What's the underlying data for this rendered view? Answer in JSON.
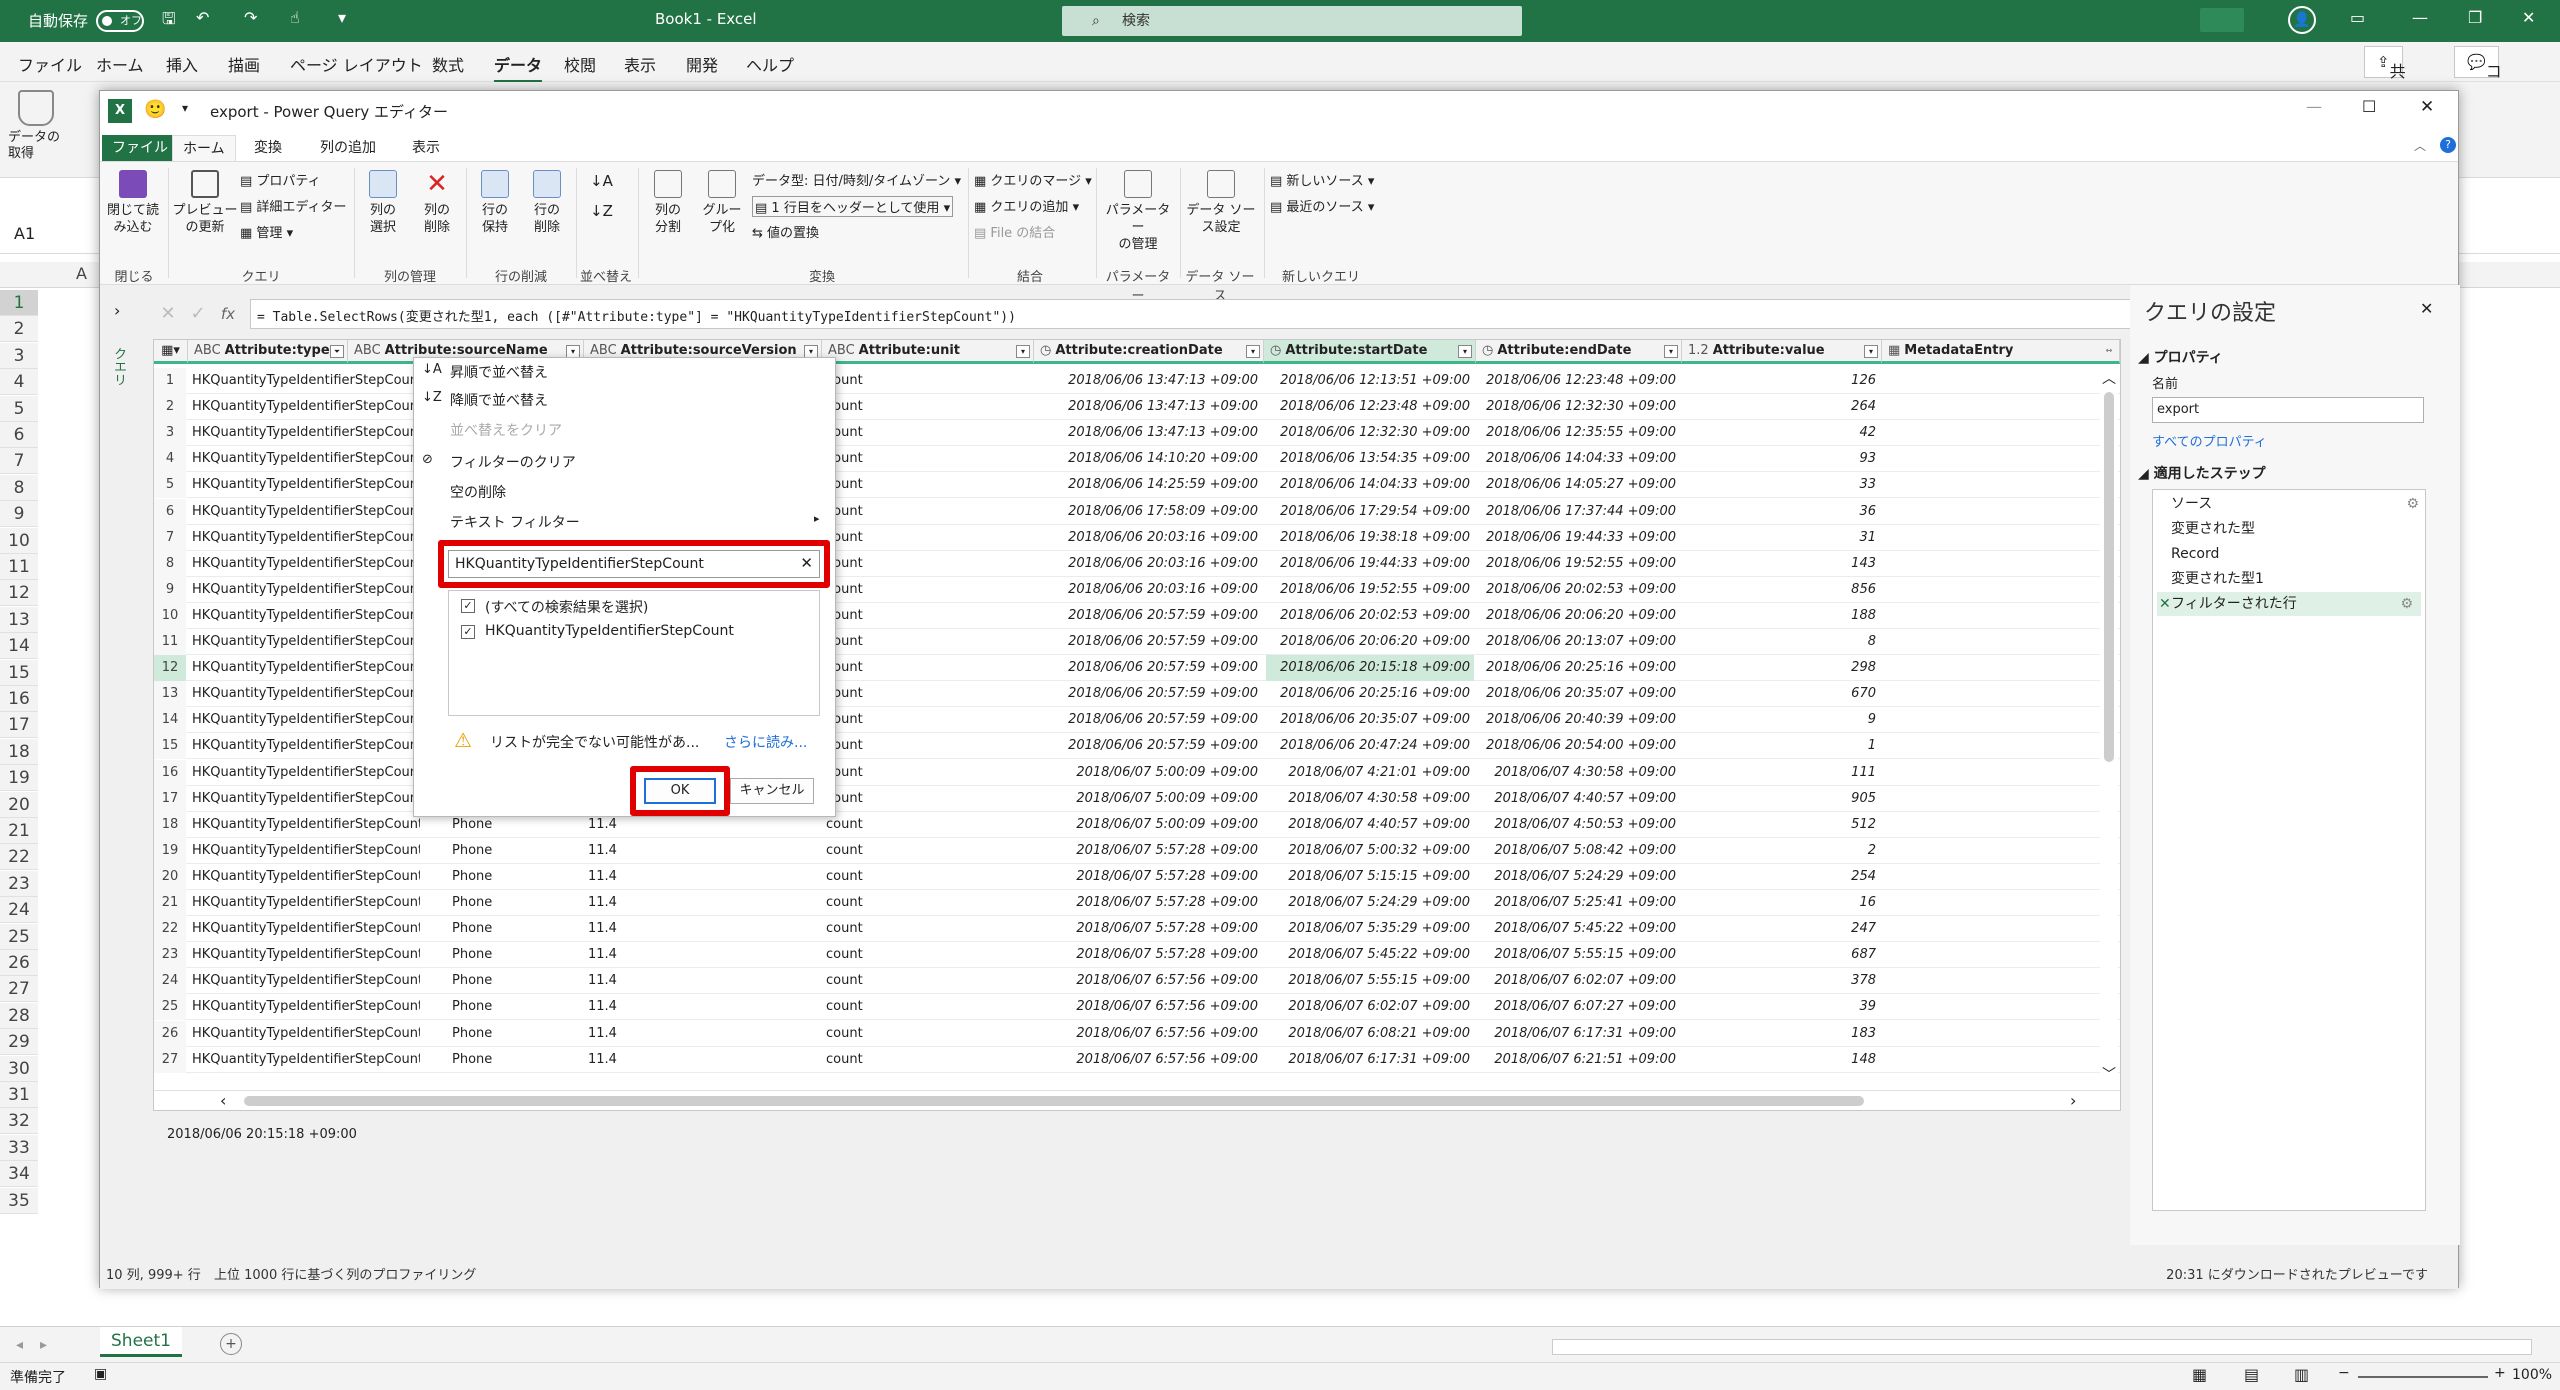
{
  "excel": {
    "autosave_label": "自動保存",
    "autosave_state": "オフ",
    "doc_title": "Book1  -  Excel",
    "search_placeholder": "検索",
    "menu": [
      "ファイル",
      "ホーム",
      "挿入",
      "描画",
      "ページ レイアウト",
      "数式",
      "データ",
      "校閲",
      "表示",
      "開発",
      "ヘルプ"
    ],
    "active_menu": "データ",
    "share_label": "共有",
    "comment_label": "コメント",
    "get_data_label": "データの\n取得",
    "name_box": "A1",
    "col_a": "A",
    "rows": [
      "1",
      "2",
      "3",
      "4",
      "5",
      "6",
      "7",
      "8",
      "9",
      "10",
      "11",
      "12",
      "13",
      "14",
      "15",
      "16",
      "17",
      "18",
      "19",
      "20",
      "21",
      "22",
      "23",
      "24",
      "25",
      "26",
      "27",
      "28",
      "29",
      "30",
      "31",
      "32",
      "33",
      "34",
      "35"
    ],
    "sheet_tab": "Sheet1",
    "status_ready": "準備完了",
    "zoom": "100%"
  },
  "pq": {
    "window_title": "export - Power Query エディター",
    "tabs": [
      "ファイル",
      "ホーム",
      "変換",
      "列の追加",
      "表示"
    ],
    "ribbon": {
      "close_load": "閉じて読\nみ込む",
      "preview_refresh": "プレビュー\nの更新",
      "properties": "プロパティ",
      "advanced_editor": "詳細エディター",
      "manage": "管理",
      "choose_columns": "列の\n選択",
      "remove_columns": "列の\n削除",
      "keep_rows": "行の\n保持",
      "remove_rows": "行の\n削除",
      "split_column": "列の\n分割",
      "group_by": "グルー\nプ化",
      "data_type": "データ型: 日付/時刻/タイムゾーン",
      "first_row_header": "1 行目をヘッダーとして使用",
      "replace_values": "値の置換",
      "merge_queries": "クエリのマージ",
      "append_queries": "クエリの追加",
      "combine_files": "File の結合",
      "manage_params": "パラメーター\nの管理",
      "data_source_settings": "データ ソー\nス設定",
      "new_source": "新しいソース",
      "recent_sources": "最近のソース",
      "groups": {
        "close": "閉じる",
        "query": "クエリ",
        "manage_cols": "列の管理",
        "reduce_rows": "行の削減",
        "sort": "並べ替え",
        "transform": "変換",
        "combine": "結合",
        "parameters": "パラメーター",
        "data_sources": "データ ソース",
        "new_query": "新しいクエリ"
      }
    },
    "queries_label": "クエリ",
    "formula": "= Table.SelectRows(変更された型1, each ([#\"Attribute:type\"] = \"HKQuantityTypeIdentifierStepCount\"))",
    "columns": [
      {
        "type": "ABC",
        "name": "Attribute:type"
      },
      {
        "type": "ABC",
        "name": "Attribute:sourceName"
      },
      {
        "type": "ABC",
        "name": "Attribute:sourceVersion"
      },
      {
        "type": "ABC",
        "name": "Attribute:unit"
      },
      {
        "type": "◷",
        "name": "Attribute:creationDate"
      },
      {
        "type": "◷",
        "name": "Attribute:startDate"
      },
      {
        "type": "◷",
        "name": "Attribute:endDate"
      },
      {
        "type": "1.2",
        "name": "Attribute:value"
      },
      {
        "type": "▦",
        "name": "MetadataEntry"
      }
    ],
    "rows": [
      {
        "n": "1",
        "type": "HKQuantityTypeIdentifierStepCount",
        "src": "",
        "ver": "",
        "unit": "count",
        "cd": "2018/06/06 13:47:13 +09:00",
        "sd": "2018/06/06 12:13:51 +09:00",
        "ed": "2018/06/06 12:23:48 +09:00",
        "v": "126"
      },
      {
        "n": "2",
        "type": "HKQuantityTypeIdentifierStepCount",
        "src": "",
        "ver": "",
        "unit": "count",
        "cd": "2018/06/06 13:47:13 +09:00",
        "sd": "2018/06/06 12:23:48 +09:00",
        "ed": "2018/06/06 12:32:30 +09:00",
        "v": "264"
      },
      {
        "n": "3",
        "type": "HKQuantityTypeIdentifierStepCount",
        "src": "",
        "ver": "",
        "unit": "count",
        "cd": "2018/06/06 13:47:13 +09:00",
        "sd": "2018/06/06 12:32:30 +09:00",
        "ed": "2018/06/06 12:35:55 +09:00",
        "v": "42"
      },
      {
        "n": "4",
        "type": "HKQuantityTypeIdentifierStepCount",
        "src": "",
        "ver": "",
        "unit": "count",
        "cd": "2018/06/06 14:10:20 +09:00",
        "sd": "2018/06/06 13:54:35 +09:00",
        "ed": "2018/06/06 14:04:33 +09:00",
        "v": "93"
      },
      {
        "n": "5",
        "type": "HKQuantityTypeIdentifierStepCount",
        "src": "",
        "ver": "",
        "unit": "count",
        "cd": "2018/06/06 14:25:59 +09:00",
        "sd": "2018/06/06 14:04:33 +09:00",
        "ed": "2018/06/06 14:05:27 +09:00",
        "v": "33"
      },
      {
        "n": "6",
        "type": "HKQuantityTypeIdentifierStepCount",
        "src": "",
        "ver": "",
        "unit": "count",
        "cd": "2018/06/06 17:58:09 +09:00",
        "sd": "2018/06/06 17:29:54 +09:00",
        "ed": "2018/06/06 17:37:44 +09:00",
        "v": "36"
      },
      {
        "n": "7",
        "type": "HKQuantityTypeIdentifierStepCount",
        "src": "",
        "ver": "",
        "unit": "count",
        "cd": "2018/06/06 20:03:16 +09:00",
        "sd": "2018/06/06 19:38:18 +09:00",
        "ed": "2018/06/06 19:44:33 +09:00",
        "v": "31"
      },
      {
        "n": "8",
        "type": "HKQuantityTypeIdentifierStepCount",
        "src": "",
        "ver": "",
        "unit": "count",
        "cd": "2018/06/06 20:03:16 +09:00",
        "sd": "2018/06/06 19:44:33 +09:00",
        "ed": "2018/06/06 19:52:55 +09:00",
        "v": "143"
      },
      {
        "n": "9",
        "type": "HKQuantityTypeIdentifierStepCount",
        "src": "",
        "ver": "",
        "unit": "count",
        "cd": "2018/06/06 20:03:16 +09:00",
        "sd": "2018/06/06 19:52:55 +09:00",
        "ed": "2018/06/06 20:02:53 +09:00",
        "v": "856"
      },
      {
        "n": "10",
        "type": "HKQuantityTypeIdentifierStepCount",
        "src": "",
        "ver": "",
        "unit": "count",
        "cd": "2018/06/06 20:57:59 +09:00",
        "sd": "2018/06/06 20:02:53 +09:00",
        "ed": "2018/06/06 20:06:20 +09:00",
        "v": "188"
      },
      {
        "n": "11",
        "type": "HKQuantityTypeIdentifierStepCount",
        "src": "",
        "ver": "",
        "unit": "count",
        "cd": "2018/06/06 20:57:59 +09:00",
        "sd": "2018/06/06 20:06:20 +09:00",
        "ed": "2018/06/06 20:13:07 +09:00",
        "v": "8"
      },
      {
        "n": "12",
        "type": "HKQuantityTypeIdentifierStepCount",
        "src": "",
        "ver": "",
        "unit": "count",
        "cd": "2018/06/06 20:57:59 +09:00",
        "sd": "2018/06/06 20:15:18 +09:00",
        "ed": "2018/06/06 20:25:16 +09:00",
        "v": "298"
      },
      {
        "n": "13",
        "type": "HKQuantityTypeIdentifierStepCount",
        "src": "",
        "ver": "",
        "unit": "count",
        "cd": "2018/06/06 20:57:59 +09:00",
        "sd": "2018/06/06 20:25:16 +09:00",
        "ed": "2018/06/06 20:35:07 +09:00",
        "v": "670"
      },
      {
        "n": "14",
        "type": "HKQuantityTypeIdentifierStepCount",
        "src": "",
        "ver": "",
        "unit": "count",
        "cd": "2018/06/06 20:57:59 +09:00",
        "sd": "2018/06/06 20:35:07 +09:00",
        "ed": "2018/06/06 20:40:39 +09:00",
        "v": "9"
      },
      {
        "n": "15",
        "type": "HKQuantityTypeIdentifierStepCount",
        "src": "",
        "ver": "",
        "unit": "count",
        "cd": "2018/06/06 20:57:59 +09:00",
        "sd": "2018/06/06 20:47:24 +09:00",
        "ed": "2018/06/06 20:54:00 +09:00",
        "v": "1"
      },
      {
        "n": "16",
        "type": "HKQuantityTypeIdentifierStepCount",
        "src": "",
        "ver": "",
        "unit": "count",
        "cd": "2018/06/07 5:00:09 +09:00",
        "sd": "2018/06/07 4:21:01 +09:00",
        "ed": "2018/06/07 4:30:58 +09:00",
        "v": "111"
      },
      {
        "n": "17",
        "type": "HKQuantityTypeIdentifierStepCount",
        "src": "",
        "ver": "",
        "unit": "count",
        "cd": "2018/06/07 5:00:09 +09:00",
        "sd": "2018/06/07 4:30:58 +09:00",
        "ed": "2018/06/07 4:40:57 +09:00",
        "v": "905"
      },
      {
        "n": "18",
        "type": "HKQuantityTypeIdentifierStepCount",
        "src": "Phone",
        "ver": "11.4",
        "unit": "count",
        "cd": "2018/06/07 5:00:09 +09:00",
        "sd": "2018/06/07 4:40:57 +09:00",
        "ed": "2018/06/07 4:50:53 +09:00",
        "v": "512"
      },
      {
        "n": "19",
        "type": "HKQuantityTypeIdentifierStepCount",
        "src": "Phone",
        "ver": "11.4",
        "unit": "count",
        "cd": "2018/06/07 5:57:28 +09:00",
        "sd": "2018/06/07 5:00:32 +09:00",
        "ed": "2018/06/07 5:08:42 +09:00",
        "v": "2"
      },
      {
        "n": "20",
        "type": "HKQuantityTypeIdentifierStepCount",
        "src": "Phone",
        "ver": "11.4",
        "unit": "count",
        "cd": "2018/06/07 5:57:28 +09:00",
        "sd": "2018/06/07 5:15:15 +09:00",
        "ed": "2018/06/07 5:24:29 +09:00",
        "v": "254"
      },
      {
        "n": "21",
        "type": "HKQuantityTypeIdentifierStepCount",
        "src": "Phone",
        "ver": "11.4",
        "unit": "count",
        "cd": "2018/06/07 5:57:28 +09:00",
        "sd": "2018/06/07 5:24:29 +09:00",
        "ed": "2018/06/07 5:25:41 +09:00",
        "v": "16"
      },
      {
        "n": "22",
        "type": "HKQuantityTypeIdentifierStepCount",
        "src": "Phone",
        "ver": "11.4",
        "unit": "count",
        "cd": "2018/06/07 5:57:28 +09:00",
        "sd": "2018/06/07 5:35:29 +09:00",
        "ed": "2018/06/07 5:45:22 +09:00",
        "v": "247"
      },
      {
        "n": "23",
        "type": "HKQuantityTypeIdentifierStepCount",
        "src": "Phone",
        "ver": "11.4",
        "unit": "count",
        "cd": "2018/06/07 5:57:28 +09:00",
        "sd": "2018/06/07 5:45:22 +09:00",
        "ed": "2018/06/07 5:55:15 +09:00",
        "v": "687"
      },
      {
        "n": "24",
        "type": "HKQuantityTypeIdentifierStepCount",
        "src": "Phone",
        "ver": "11.4",
        "unit": "count",
        "cd": "2018/06/07 6:57:56 +09:00",
        "sd": "2018/06/07 5:55:15 +09:00",
        "ed": "2018/06/07 6:02:07 +09:00",
        "v": "378"
      },
      {
        "n": "25",
        "type": "HKQuantityTypeIdentifierStepCount",
        "src": "Phone",
        "ver": "11.4",
        "unit": "count",
        "cd": "2018/06/07 6:57:56 +09:00",
        "sd": "2018/06/07 6:02:07 +09:00",
        "ed": "2018/06/07 6:07:27 +09:00",
        "v": "39"
      },
      {
        "n": "26",
        "type": "HKQuantityTypeIdentifierStepCount",
        "src": "Phone",
        "ver": "11.4",
        "unit": "count",
        "cd": "2018/06/07 6:57:56 +09:00",
        "sd": "2018/06/07 6:08:21 +09:00",
        "ed": "2018/06/07 6:17:31 +09:00",
        "v": "183"
      },
      {
        "n": "27",
        "type": "HKQuantityTypeIdentifierStepCount",
        "src": "Phone",
        "ver": "11.4",
        "unit": "count",
        "cd": "2018/06/07 6:57:56 +09:00",
        "sd": "2018/06/07 6:17:31 +09:00",
        "ed": "2018/06/07 6:21:51 +09:00",
        "v": "148"
      }
    ],
    "cell_preview": "2018/06/06 20:15:18 +09:00",
    "status_left": "10 列, 999+ 行",
    "status_mid": "上位 1000 行に基づく列のプロファイリング",
    "status_right": "20:31 にダウンロードされたプレビューです",
    "filter_popup": {
      "sort_asc": "昇順で並べ替え",
      "sort_desc": "降順で並べ替え",
      "clear_sort": "並べ替えをクリア",
      "clear_filter": "フィルターのクリア",
      "remove_empty": "空の削除",
      "text_filter": "テキスト フィルター",
      "search_value": "HKQuantityTypeIdentifierStepCount",
      "select_all": "(すべての検索結果を選択)",
      "item": "HKQuantityTypeIdentifierStepCount",
      "warning": "リストが完全でない可能性があ...",
      "load_more": "さらに読み...",
      "ok": "OK",
      "cancel": "キャンセル"
    },
    "settings": {
      "title": "クエリの設定",
      "properties": "プロパティ",
      "name_label": "名前",
      "name_value": "export",
      "all_properties": "すべてのプロパティ",
      "applied_steps": "適用したステップ",
      "steps": [
        "ソース",
        "変更された型",
        "Record",
        "変更された型1",
        "フィルターされた行"
      ]
    }
  }
}
